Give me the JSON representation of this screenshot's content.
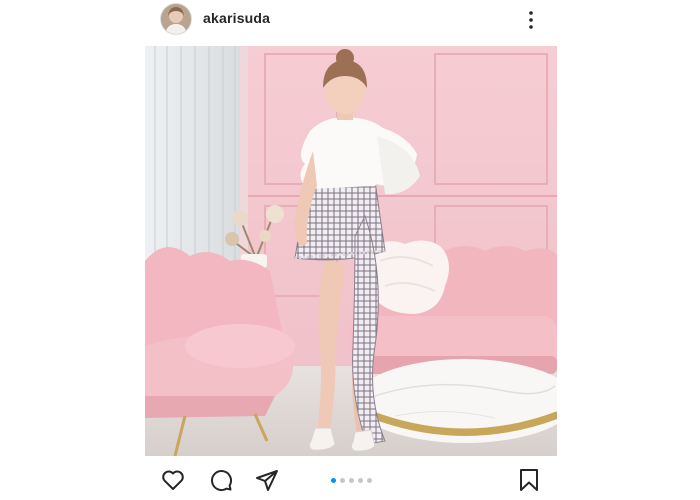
{
  "post": {
    "username": "akarisuda",
    "carousel": {
      "total": 5,
      "active": 1
    }
  },
  "colors": {
    "wall": "#f3c6cd",
    "carousel_active": "#0095f6",
    "carousel_inactive": "#c7c7c7"
  },
  "icons": {
    "more": "more-vertical-icon",
    "like": "heart-icon",
    "comment": "comment-icon",
    "share": "share-icon",
    "save": "bookmark-icon"
  }
}
